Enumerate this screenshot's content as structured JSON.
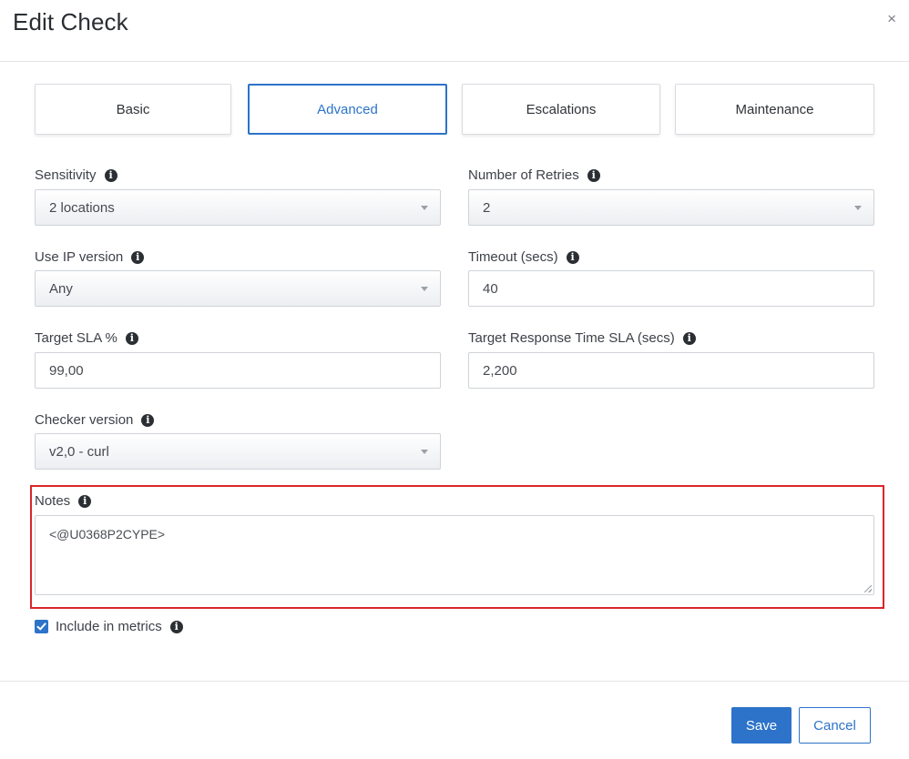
{
  "dialog": {
    "title": "Edit Check",
    "close_label": "×"
  },
  "tabs": [
    {
      "label": "Basic",
      "active": false
    },
    {
      "label": "Advanced",
      "active": true
    },
    {
      "label": "Escalations",
      "active": false
    },
    {
      "label": "Maintenance",
      "active": false
    }
  ],
  "fields": {
    "sensitivity": {
      "label": "Sensitivity",
      "value": "2 locations",
      "type": "select"
    },
    "retries": {
      "label": "Number of Retries",
      "value": "2",
      "type": "select"
    },
    "ip_version": {
      "label": "Use IP version",
      "value": "Any",
      "type": "select"
    },
    "timeout": {
      "label": "Timeout (secs)",
      "value": "40",
      "type": "input"
    },
    "target_sla": {
      "label": "Target SLA %",
      "value": "99,00",
      "type": "input"
    },
    "response_sla": {
      "label": "Target Response Time SLA (secs)",
      "value": "2,200",
      "type": "input"
    },
    "checker_version": {
      "label": "Checker version",
      "value": "v2,0 - curl",
      "type": "select"
    },
    "notes": {
      "label": "Notes",
      "value": "<@U0368P2CYPE>"
    }
  },
  "include_metrics": {
    "label": "Include in metrics",
    "checked": true
  },
  "footer": {
    "save_label": "Save",
    "cancel_label": "Cancel"
  },
  "info_glyph": "i",
  "icons": [
    "info-icon",
    "close-icon",
    "chevron-down-icon",
    "checkmark-icon"
  ],
  "colors": {
    "accent": "#2c73c9",
    "highlight_border": "#d9262b"
  }
}
